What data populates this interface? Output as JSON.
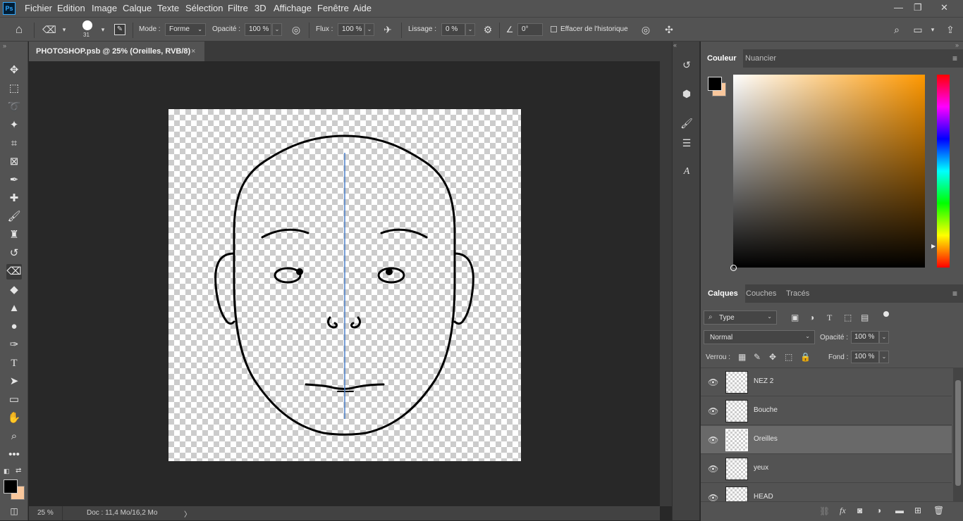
{
  "app": {
    "logo": "Ps"
  },
  "menu": [
    "Fichier",
    "Edition",
    "Image",
    "Calque",
    "Texte",
    "Sélection",
    "Filtre",
    "3D",
    "Affichage",
    "Fenêtre",
    "Aide"
  ],
  "window_controls": {
    "minimize": "—",
    "restore": "❐",
    "close": "✕"
  },
  "options": {
    "brush_size": "31",
    "mode_label": "Mode :",
    "mode_value": "Forme",
    "opacity_label": "Opacité :",
    "opacity_value": "100 %",
    "flow_label": "Flux :",
    "flow_value": "100 %",
    "smoothing_label": "Lissage :",
    "smoothing_value": "0 %",
    "angle_value": "0°",
    "erase_history_label": "Effacer de l'historique"
  },
  "document": {
    "tab_title": "PHOTOSHOP.psb @ 25% (Oreilles, RVB/8)",
    "tab_close": "×"
  },
  "status": {
    "zoom": "25 %",
    "doc_info": "Doc : 11,4 Mo/16,2 Mo",
    "arrow": "〉"
  },
  "color_panel": {
    "tabs": [
      "Couleur",
      "Nuancier"
    ],
    "foreground": "#000000",
    "background": "#f9c79c",
    "hue_color": "#ff9800"
  },
  "layers_panel": {
    "tabs": [
      "Calques",
      "Couches",
      "Tracés"
    ],
    "filter_label": "Type",
    "blend_mode": "Normal",
    "opacity_label": "Opacité :",
    "opacity_value": "100 %",
    "lock_label": "Verrou :",
    "fill_label": "Fond :",
    "fill_value": "100 %",
    "layers": [
      {
        "name": "NEZ 2",
        "selected": false
      },
      {
        "name": "Bouche",
        "selected": false
      },
      {
        "name": "Oreilles",
        "selected": true
      },
      {
        "name": "yeux",
        "selected": false
      },
      {
        "name": "HEAD",
        "selected": false
      }
    ]
  }
}
